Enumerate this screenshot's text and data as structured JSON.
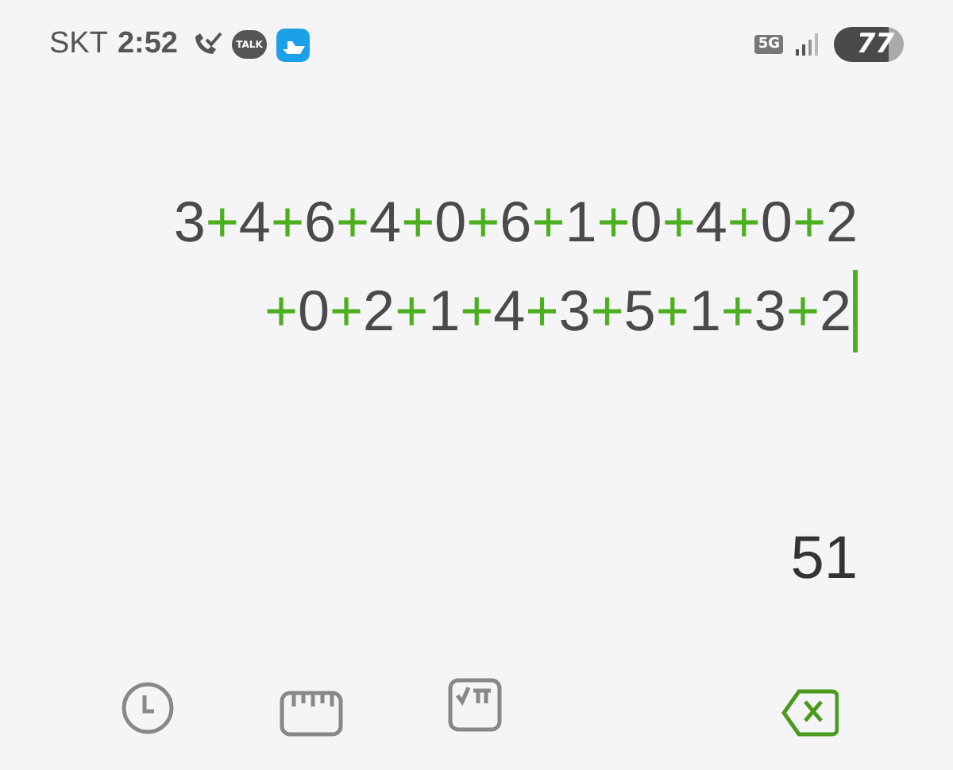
{
  "status_bar": {
    "carrier": "SKT",
    "time": "2:52",
    "chat_badge": "TALK",
    "network": "5G",
    "battery": "77"
  },
  "expression": {
    "lines": [
      [
        {
          "kind": "digit",
          "text": "3"
        },
        {
          "kind": "operator",
          "text": "+"
        },
        {
          "kind": "digit",
          "text": "4"
        },
        {
          "kind": "operator",
          "text": "+"
        },
        {
          "kind": "digit",
          "text": "6"
        },
        {
          "kind": "operator",
          "text": "+"
        },
        {
          "kind": "digit",
          "text": "4"
        },
        {
          "kind": "operator",
          "text": "+"
        },
        {
          "kind": "digit",
          "text": "0"
        },
        {
          "kind": "operator",
          "text": "+"
        },
        {
          "kind": "digit",
          "text": "6"
        },
        {
          "kind": "operator",
          "text": "+"
        },
        {
          "kind": "digit",
          "text": "1"
        },
        {
          "kind": "operator",
          "text": "+"
        },
        {
          "kind": "digit",
          "text": "0"
        },
        {
          "kind": "operator",
          "text": "+"
        },
        {
          "kind": "digit",
          "text": "4"
        },
        {
          "kind": "operator",
          "text": "+"
        },
        {
          "kind": "digit",
          "text": "0"
        },
        {
          "kind": "operator",
          "text": "+"
        },
        {
          "kind": "digit",
          "text": "2"
        }
      ],
      [
        {
          "kind": "operator",
          "text": "+"
        },
        {
          "kind": "digit",
          "text": "0"
        },
        {
          "kind": "operator",
          "text": "+"
        },
        {
          "kind": "digit",
          "text": "2"
        },
        {
          "kind": "operator",
          "text": "+"
        },
        {
          "kind": "digit",
          "text": "1"
        },
        {
          "kind": "operator",
          "text": "+"
        },
        {
          "kind": "digit",
          "text": "4"
        },
        {
          "kind": "operator",
          "text": "+"
        },
        {
          "kind": "digit",
          "text": "3"
        },
        {
          "kind": "operator",
          "text": "+"
        },
        {
          "kind": "digit",
          "text": "5"
        },
        {
          "kind": "operator",
          "text": "+"
        },
        {
          "kind": "digit",
          "text": "1"
        },
        {
          "kind": "operator",
          "text": "+"
        },
        {
          "kind": "digit",
          "text": "3"
        },
        {
          "kind": "operator",
          "text": "+"
        },
        {
          "kind": "digit",
          "text": "2"
        }
      ]
    ],
    "cursor": true
  },
  "result": "51"
}
